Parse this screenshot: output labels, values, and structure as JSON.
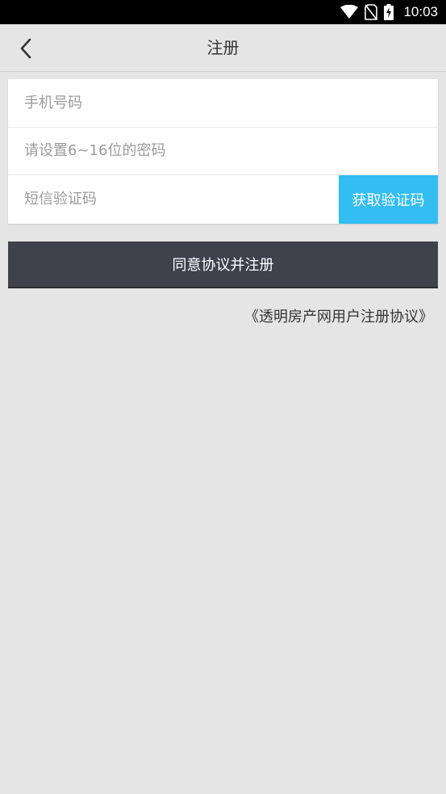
{
  "status_bar": {
    "time": "10:03",
    "icons": [
      "wifi-icon",
      "no-sim-icon",
      "battery-charging-icon"
    ]
  },
  "nav": {
    "title": "注册",
    "back_icon": "chevron-left-icon"
  },
  "form": {
    "phone_placeholder": "手机号码",
    "password_placeholder": "请设置6~16位的密码",
    "sms_placeholder": "短信验证码",
    "get_code_label": "获取验证码"
  },
  "actions": {
    "register_label": "同意协议并注册",
    "agreement_link": "《透明房产网用户注册协议》"
  },
  "colors": {
    "background": "#e5e5e5",
    "accent": "#34bdf0",
    "primary_button": "#3f414c"
  }
}
